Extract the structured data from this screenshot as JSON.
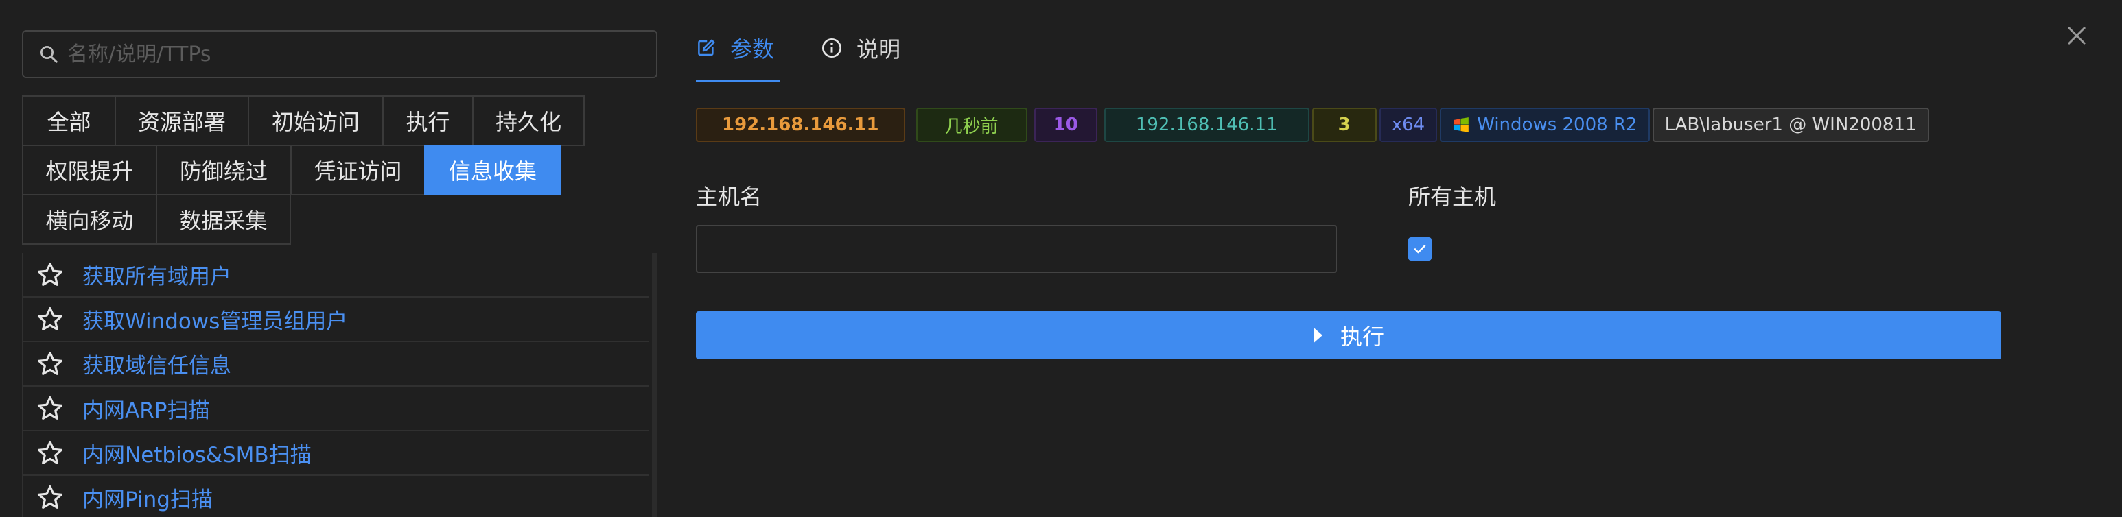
{
  "search": {
    "placeholder": "名称/说明/TTPs",
    "icon": "search-icon"
  },
  "categories": [
    [
      "全部",
      "资源部署",
      "初始访问",
      "执行",
      "持久化"
    ],
    [
      "权限提升",
      "防御绕过",
      "凭证访问",
      "信息收集"
    ],
    [
      "横向移动",
      "数据采集"
    ]
  ],
  "active_category": "信息收集",
  "modules": [
    {
      "label": "获取所有域用户",
      "icon": "star-icon"
    },
    {
      "label": "获取Windows管理员组用户",
      "icon": "star-icon"
    },
    {
      "label": "获取域信任信息",
      "icon": "star-icon"
    },
    {
      "label": "内网ARP扫描",
      "icon": "star-icon"
    },
    {
      "label": "内网Netbios&SMB扫描",
      "icon": "star-icon"
    },
    {
      "label": "内网Ping扫描",
      "icon": "star-icon"
    }
  ],
  "right_tabs": {
    "params": {
      "label": "参数",
      "icon": "edit-icon"
    },
    "description": {
      "label": "说明",
      "icon": "info-icon"
    }
  },
  "session": {
    "external_ip": "192.168.146.11",
    "last_seen": "几秒前",
    "pid_count": "10",
    "internal_ip": "192.168.146.11",
    "sleep": "3",
    "arch": "x64",
    "os": "Windows 2008 R2",
    "user": "LAB\\labuser1 @ WIN200811"
  },
  "form": {
    "hostname_label": "主机名",
    "hostname_value": "",
    "all_hosts_label": "所有主机",
    "all_hosts_checked": true,
    "execute_label": "执行"
  },
  "colors": {
    "accent": "#3f8bf0",
    "background": "#1f1f1f"
  }
}
